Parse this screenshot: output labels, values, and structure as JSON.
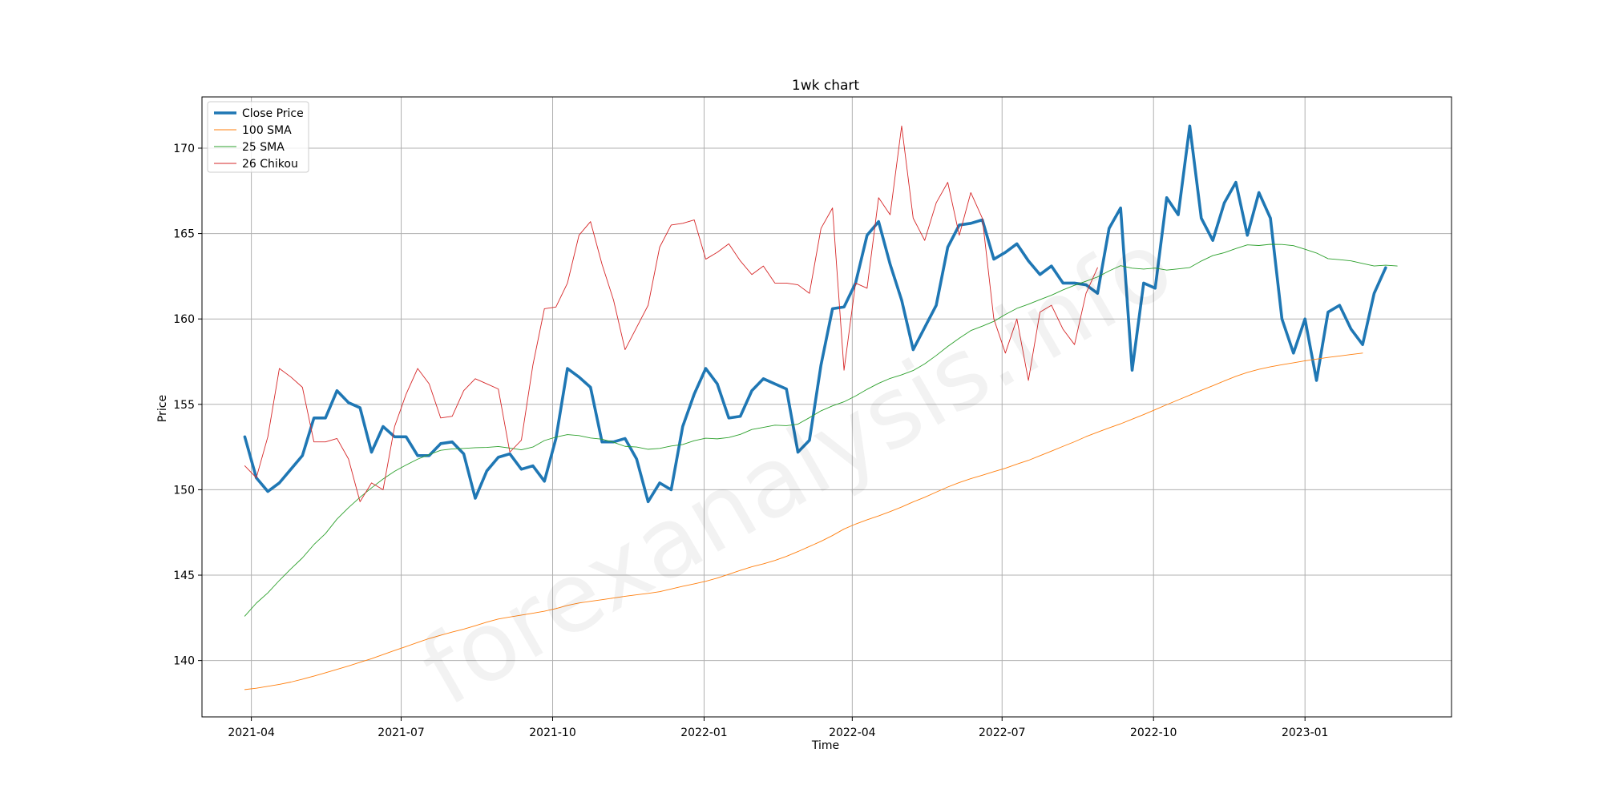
{
  "chart_data": {
    "type": "line",
    "title": "1wk chart",
    "xlabel": "Time",
    "ylabel": "Price",
    "ylim": [
      136.7,
      173.0
    ],
    "xlim": [
      "2021-03-02",
      "2023-03-31"
    ],
    "grid": true,
    "legend_position": "top-left",
    "watermark": "forexanalysis.info",
    "x_ticks": [
      "2021-04",
      "2021-07",
      "2021-10",
      "2022-01",
      "2022-04",
      "2022-07",
      "2022-10",
      "2023-01"
    ],
    "y_ticks": [
      140,
      145,
      150,
      155,
      160,
      165,
      170
    ],
    "x_start": "2021-03-28",
    "series": [
      {
        "name": "Close Price",
        "color": "#1f77b4",
        "values": [
          153.1,
          150.7,
          149.9,
          150.4,
          151.2,
          152.0,
          154.2,
          154.2,
          155.8,
          155.1,
          154.8,
          152.2,
          153.7,
          153.1,
          153.1,
          152.0,
          152.0,
          152.7,
          152.8,
          152.1,
          149.5,
          151.1,
          151.9,
          152.1,
          151.2,
          151.4,
          150.5,
          153.0,
          157.1,
          156.6,
          156.0,
          152.8,
          152.8,
          153.0,
          151.8,
          149.3,
          150.4,
          150.0,
          153.7,
          155.6,
          157.1,
          156.2,
          154.2,
          154.3,
          155.8,
          156.5,
          156.2,
          155.9,
          152.2,
          152.9,
          157.3,
          160.6,
          160.7,
          162.1,
          164.9,
          165.7,
          163.2,
          161.1,
          158.2,
          159.5,
          160.8,
          164.2,
          165.5,
          165.6,
          165.8,
          163.5,
          163.9,
          164.4,
          163.4,
          162.6,
          163.1,
          162.1,
          162.1,
          162.0,
          161.5,
          165.3,
          166.5,
          157.0,
          162.1,
          161.8,
          167.1,
          166.1,
          171.3,
          165.9,
          164.6,
          166.8,
          168.0,
          164.9,
          167.4,
          165.9,
          160.0,
          158.0,
          160.0,
          156.4,
          160.4,
          160.8,
          159.4,
          158.5,
          161.5,
          163.0
        ]
      },
      {
        "name": "100 SMA",
        "color": "#ff7f0e",
        "values": [
          138.3,
          138.38,
          138.49,
          138.6,
          138.74,
          138.91,
          139.09,
          139.28,
          139.48,
          139.68,
          139.9,
          140.11,
          140.35,
          140.59,
          140.82,
          141.06,
          141.29,
          141.48,
          141.67,
          141.84,
          142.04,
          142.25,
          142.43,
          142.55,
          142.66,
          142.77,
          142.89,
          143.04,
          143.23,
          143.37,
          143.47,
          143.56,
          143.66,
          143.76,
          143.85,
          143.93,
          144.03,
          144.19,
          144.35,
          144.49,
          144.64,
          144.83,
          145.05,
          145.28,
          145.49,
          145.66,
          145.86,
          146.1,
          146.38,
          146.68,
          146.98,
          147.32,
          147.7,
          147.99,
          148.24,
          148.47,
          148.72,
          148.99,
          149.29,
          149.56,
          149.86,
          150.16,
          150.42,
          150.65,
          150.85,
          151.06,
          151.26,
          151.5,
          151.72,
          151.99,
          152.26,
          152.54,
          152.81,
          153.11,
          153.37,
          153.62,
          153.86,
          154.13,
          154.4,
          154.69,
          154.98,
          155.26,
          155.54,
          155.82,
          156.09,
          156.37,
          156.64,
          156.87,
          157.05,
          157.2,
          157.32,
          157.43,
          157.55,
          157.65,
          157.75,
          157.83,
          157.92,
          158.0
        ]
      },
      {
        "name": "25 SMA",
        "color": "#2ca02c",
        "values": [
          142.6,
          143.36,
          143.96,
          144.69,
          145.37,
          146.01,
          146.79,
          147.43,
          148.28,
          148.95,
          149.56,
          150.11,
          150.63,
          151.08,
          151.45,
          151.79,
          152.06,
          152.31,
          152.39,
          152.42,
          152.46,
          152.48,
          152.53,
          152.44,
          152.34,
          152.5,
          152.88,
          153.08,
          153.23,
          153.17,
          153.03,
          152.96,
          152.78,
          152.54,
          152.5,
          152.37,
          152.42,
          152.56,
          152.65,
          152.87,
          153.02,
          152.98,
          153.06,
          153.24,
          153.53,
          153.65,
          153.78,
          153.75,
          153.84,
          154.22,
          154.62,
          154.91,
          155.15,
          155.49,
          155.88,
          156.23,
          156.52,
          156.73,
          156.98,
          157.37,
          157.86,
          158.39,
          158.87,
          159.32,
          159.58,
          159.86,
          160.26,
          160.62,
          160.86,
          161.13,
          161.39,
          161.7,
          161.97,
          162.21,
          162.46,
          162.81,
          163.12,
          162.97,
          162.92,
          162.98,
          162.86,
          162.93,
          163.01,
          163.39,
          163.71,
          163.88,
          164.12,
          164.34,
          164.3,
          164.37,
          164.36,
          164.29,
          164.08,
          163.86,
          163.53,
          163.47,
          163.4,
          163.25,
          163.1,
          163.15,
          163.1
        ]
      },
      {
        "name": "26 Chikou",
        "color": "#d62728",
        "values": [
          151.4,
          150.7,
          153.1,
          157.1,
          156.6,
          156.0,
          152.8,
          152.8,
          153.0,
          151.8,
          149.3,
          150.4,
          150.0,
          153.7,
          155.6,
          157.1,
          156.2,
          154.2,
          154.3,
          155.8,
          156.5,
          156.2,
          155.9,
          152.2,
          152.9,
          157.3,
          160.6,
          160.7,
          162.1,
          164.9,
          165.7,
          163.2,
          161.1,
          158.2,
          159.5,
          160.8,
          164.2,
          165.5,
          165.6,
          165.8,
          163.5,
          163.9,
          164.4,
          163.4,
          162.6,
          163.1,
          162.1,
          162.1,
          162.0,
          161.5,
          165.3,
          166.5,
          157.0,
          162.1,
          161.8,
          167.1,
          166.1,
          171.3,
          165.9,
          164.6,
          166.8,
          168.0,
          164.9,
          167.4,
          165.9,
          160.0,
          158.0,
          160.0,
          156.4,
          160.4,
          160.8,
          159.4,
          158.5,
          161.5,
          163.0
        ]
      }
    ]
  }
}
